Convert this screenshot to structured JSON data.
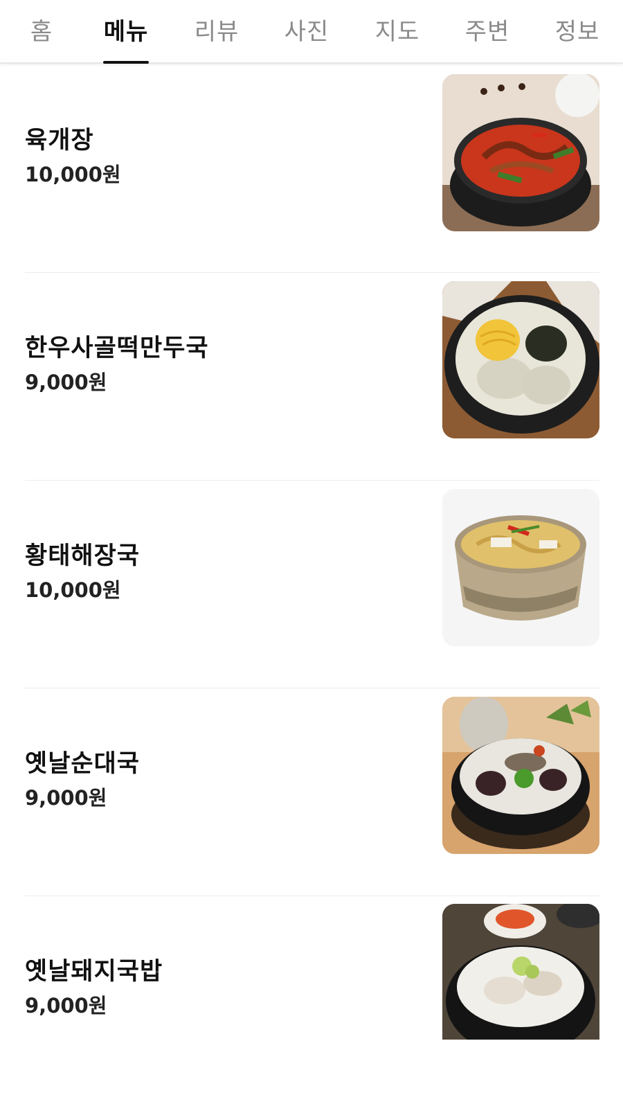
{
  "tabs": [
    {
      "label": "홈",
      "active": false
    },
    {
      "label": "메뉴",
      "active": true
    },
    {
      "label": "리뷰",
      "active": false
    },
    {
      "label": "사진",
      "active": false
    },
    {
      "label": "지도",
      "active": false
    },
    {
      "label": "주변",
      "active": false
    },
    {
      "label": "정보",
      "active": false
    }
  ],
  "menu": {
    "items": [
      {
        "name": "육개장",
        "price": "10,000원",
        "image": "yukgaejang-photo"
      },
      {
        "name": "한우사골떡만두국",
        "price": "9,000원",
        "image": "tteok-mandu-guk-photo"
      },
      {
        "name": "황태해장국",
        "price": "10,000원",
        "image": "hwangtae-haejangguk-photo"
      },
      {
        "name": "옛날순대국",
        "price": "9,000원",
        "image": "sundae-guk-photo"
      },
      {
        "name": "옛날돼지국밥",
        "price": "9,000원",
        "image": "dwaeji-gukbap-photo"
      }
    ]
  }
}
